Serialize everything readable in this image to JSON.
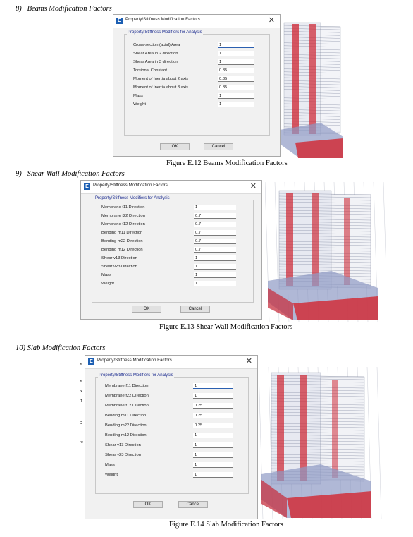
{
  "sections": [
    {
      "heading": "8)   Beams Modification Factors",
      "caption": "Figure E.12 Beams Modification Factors",
      "dialog": {
        "title": "Property/Stiffness Modification Factors",
        "group_title": "Property/Stiffness Modifiers for Analysis",
        "rows": [
          {
            "label": "Cross-section (axial) Area",
            "value": "1"
          },
          {
            "label": "Shear Area in 2 direction",
            "value": "1"
          },
          {
            "label": "Shear Area in 3 direction",
            "value": "1"
          },
          {
            "label": "Torsional Constant",
            "value": "0.35"
          },
          {
            "label": "Moment of Inertia about 2 axis",
            "value": "0.35"
          },
          {
            "label": "Moment of Inertia about 3 axis",
            "value": "0.35"
          },
          {
            "label": "Mass",
            "value": "1"
          },
          {
            "label": "Weight",
            "value": "1"
          }
        ],
        "ok_label": "OK",
        "cancel_label": "Cancel"
      }
    },
    {
      "heading": "9)   Shear Wall Modification Factors",
      "caption": "Figure E.13 Shear Wall Modification Factors",
      "dialog": {
        "title": "Property/Stiffness Modification Factors",
        "group_title": "Property/Stiffness Modifiers for Analysis",
        "rows": [
          {
            "label": "Membrane f11 Direction",
            "value": "1"
          },
          {
            "label": "Membrane f22 Direction",
            "value": "0.7"
          },
          {
            "label": "Membrane f12 Direction",
            "value": "0.7"
          },
          {
            "label": "Bending m11 Direction",
            "value": "0.7"
          },
          {
            "label": "Bending m22 Direction",
            "value": "0.7"
          },
          {
            "label": "Bending m12 Direction",
            "value": "0.7"
          },
          {
            "label": "Shear v13 Direction",
            "value": "1"
          },
          {
            "label": "Shear v23 Direction",
            "value": "1"
          },
          {
            "label": "Mass",
            "value": "1"
          },
          {
            "label": "Weight",
            "value": "1"
          }
        ],
        "ok_label": "OK",
        "cancel_label": "Cancel"
      }
    },
    {
      "heading": "10) Slab Modification Factors",
      "caption": "Figure E.14 Slab Modification Factors",
      "dialog": {
        "title": "Property/Stiffness Modification Factors",
        "group_title": "Property/Stiffness Modifiers for Analysis",
        "rows": [
          {
            "label": "Membrane f11 Direction",
            "value": "1"
          },
          {
            "label": "Membrane f22 Direction",
            "value": "1"
          },
          {
            "label": "Membrane f12 Direction",
            "value": "0.25"
          },
          {
            "label": "Bending m11 Direction",
            "value": "0.25"
          },
          {
            "label": "Bending m22 Direction",
            "value": "0.25"
          },
          {
            "label": "Bending m12 Direction",
            "value": "1"
          },
          {
            "label": "Shear v13 Direction",
            "value": "1"
          },
          {
            "label": "Shear v23 Direction",
            "value": "1"
          },
          {
            "label": "Mass",
            "value": "1"
          },
          {
            "label": "Weight",
            "value": "1"
          }
        ],
        "ok_label": "OK",
        "cancel_label": "Cancel",
        "side_letters": [
          "e",
          "e",
          "y",
          "rt",
          "D",
          "re"
        ]
      }
    }
  ],
  "app_icon_letter": "E",
  "colors": {
    "accent_blue": "#1d5fb3",
    "wall_red": "#d12e3a",
    "slab_blue": "#7f8fbf"
  }
}
